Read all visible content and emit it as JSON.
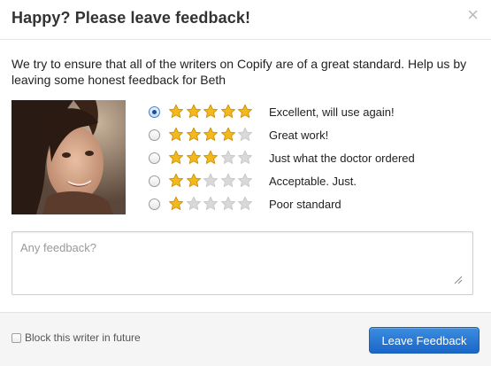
{
  "dialog": {
    "title": "Happy? Please leave feedback!",
    "close_symbol": "×",
    "intro": "We try to ensure that all of the writers on Copify are of a great standard. Help us by leaving some honest feedback for Beth"
  },
  "ratings": [
    {
      "stars": 5,
      "label": "Excellent, will use again!",
      "selected": true
    },
    {
      "stars": 4,
      "label": "Great work!",
      "selected": false
    },
    {
      "stars": 3,
      "label": "Just what the doctor ordered",
      "selected": false
    },
    {
      "stars": 2,
      "label": "Acceptable. Just.",
      "selected": false
    },
    {
      "stars": 1,
      "label": "Poor standard",
      "selected": false
    }
  ],
  "max_stars": 5,
  "feedback": {
    "value": "",
    "placeholder": "Any feedback?"
  },
  "footer": {
    "block_label": "Block this writer in future",
    "block_checked": false,
    "submit_label": "Leave Feedback"
  },
  "icons": {
    "star_filled": "star-filled-icon",
    "star_empty": "star-empty-icon",
    "close": "close-icon"
  },
  "colors": {
    "star_gold": "#f2b81c",
    "star_gold_dark": "#c98a00",
    "star_empty": "#d9d9d9",
    "button_blue": "#1b66c9"
  }
}
